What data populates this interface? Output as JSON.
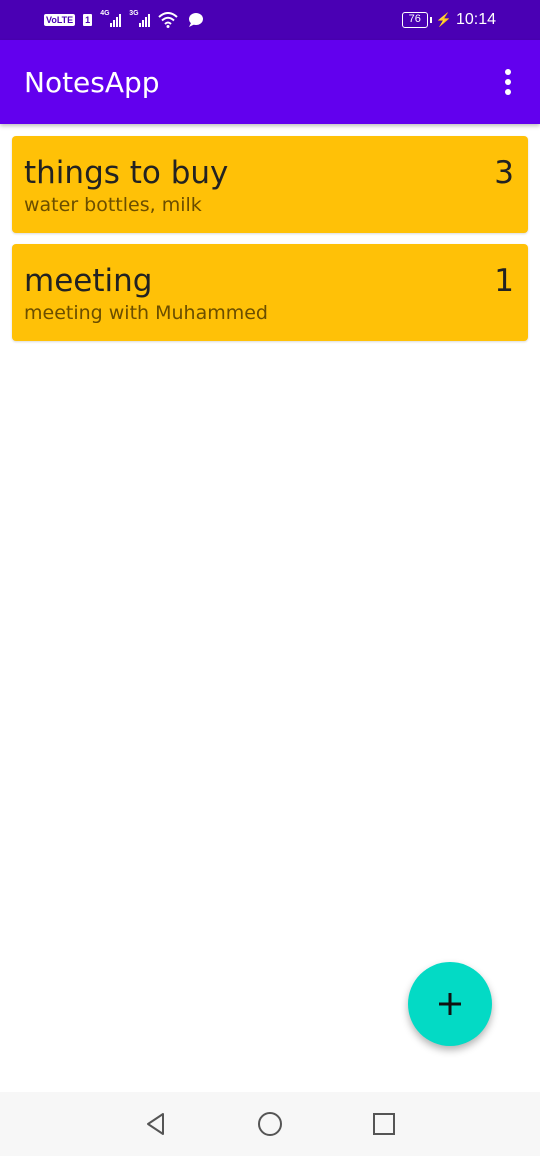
{
  "status_bar": {
    "volte": "VoLTE",
    "sim": "1",
    "network1": "4G",
    "network2": "3G",
    "battery": "76",
    "time": "10:14"
  },
  "app_bar": {
    "title": "NotesApp",
    "menu_icon": "more-vert-icon"
  },
  "notes": [
    {
      "title": "things to buy",
      "subtitle": "water bottles, milk",
      "count": "3"
    },
    {
      "title": "meeting",
      "subtitle": "meeting with Muhammed",
      "count": "1"
    }
  ],
  "fab": {
    "icon": "plus-icon"
  },
  "nav_bar": {
    "icons": [
      "back-icon",
      "home-icon",
      "recents-icon"
    ]
  },
  "colors": {
    "status_bar": "#4a00b4",
    "app_bar": "#6200ee",
    "note_card": "#ffc107",
    "fab": "#03dac5"
  }
}
